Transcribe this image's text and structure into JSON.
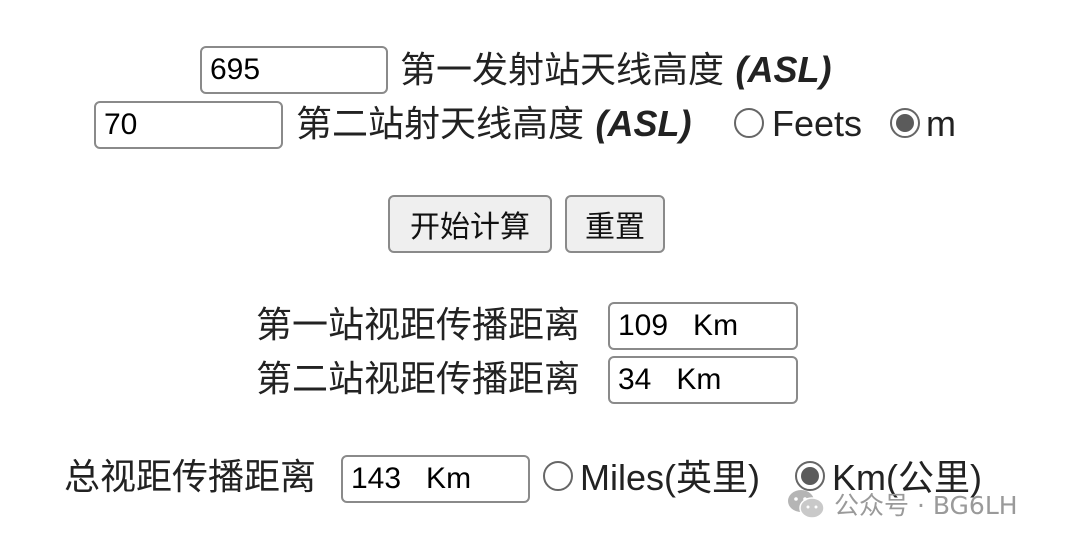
{
  "station1": {
    "height_value": "695",
    "height_label": "第一发射站天线高度",
    "asl": "(ASL)"
  },
  "station2": {
    "height_value": "70",
    "height_label": "第二站射天线高度",
    "asl": "(ASL)"
  },
  "height_units": {
    "options": [
      "Feets",
      "m"
    ],
    "selected": "m"
  },
  "buttons": {
    "calculate": "开始计算",
    "reset": "重置"
  },
  "results": {
    "station1_label": "第一站视距传播距离",
    "station1_value": "109   Km",
    "station2_label": "第二站视距传播距离",
    "station2_value": "34   Km",
    "total_label": "总视距传播距离",
    "total_value": "143   Km"
  },
  "distance_units": {
    "options": [
      "Miles(英里)",
      "Km(公里)"
    ],
    "selected": "Km(公里)"
  },
  "watermark": {
    "text": "公众号 · BG6LH",
    "icon": "wechat-icon"
  }
}
